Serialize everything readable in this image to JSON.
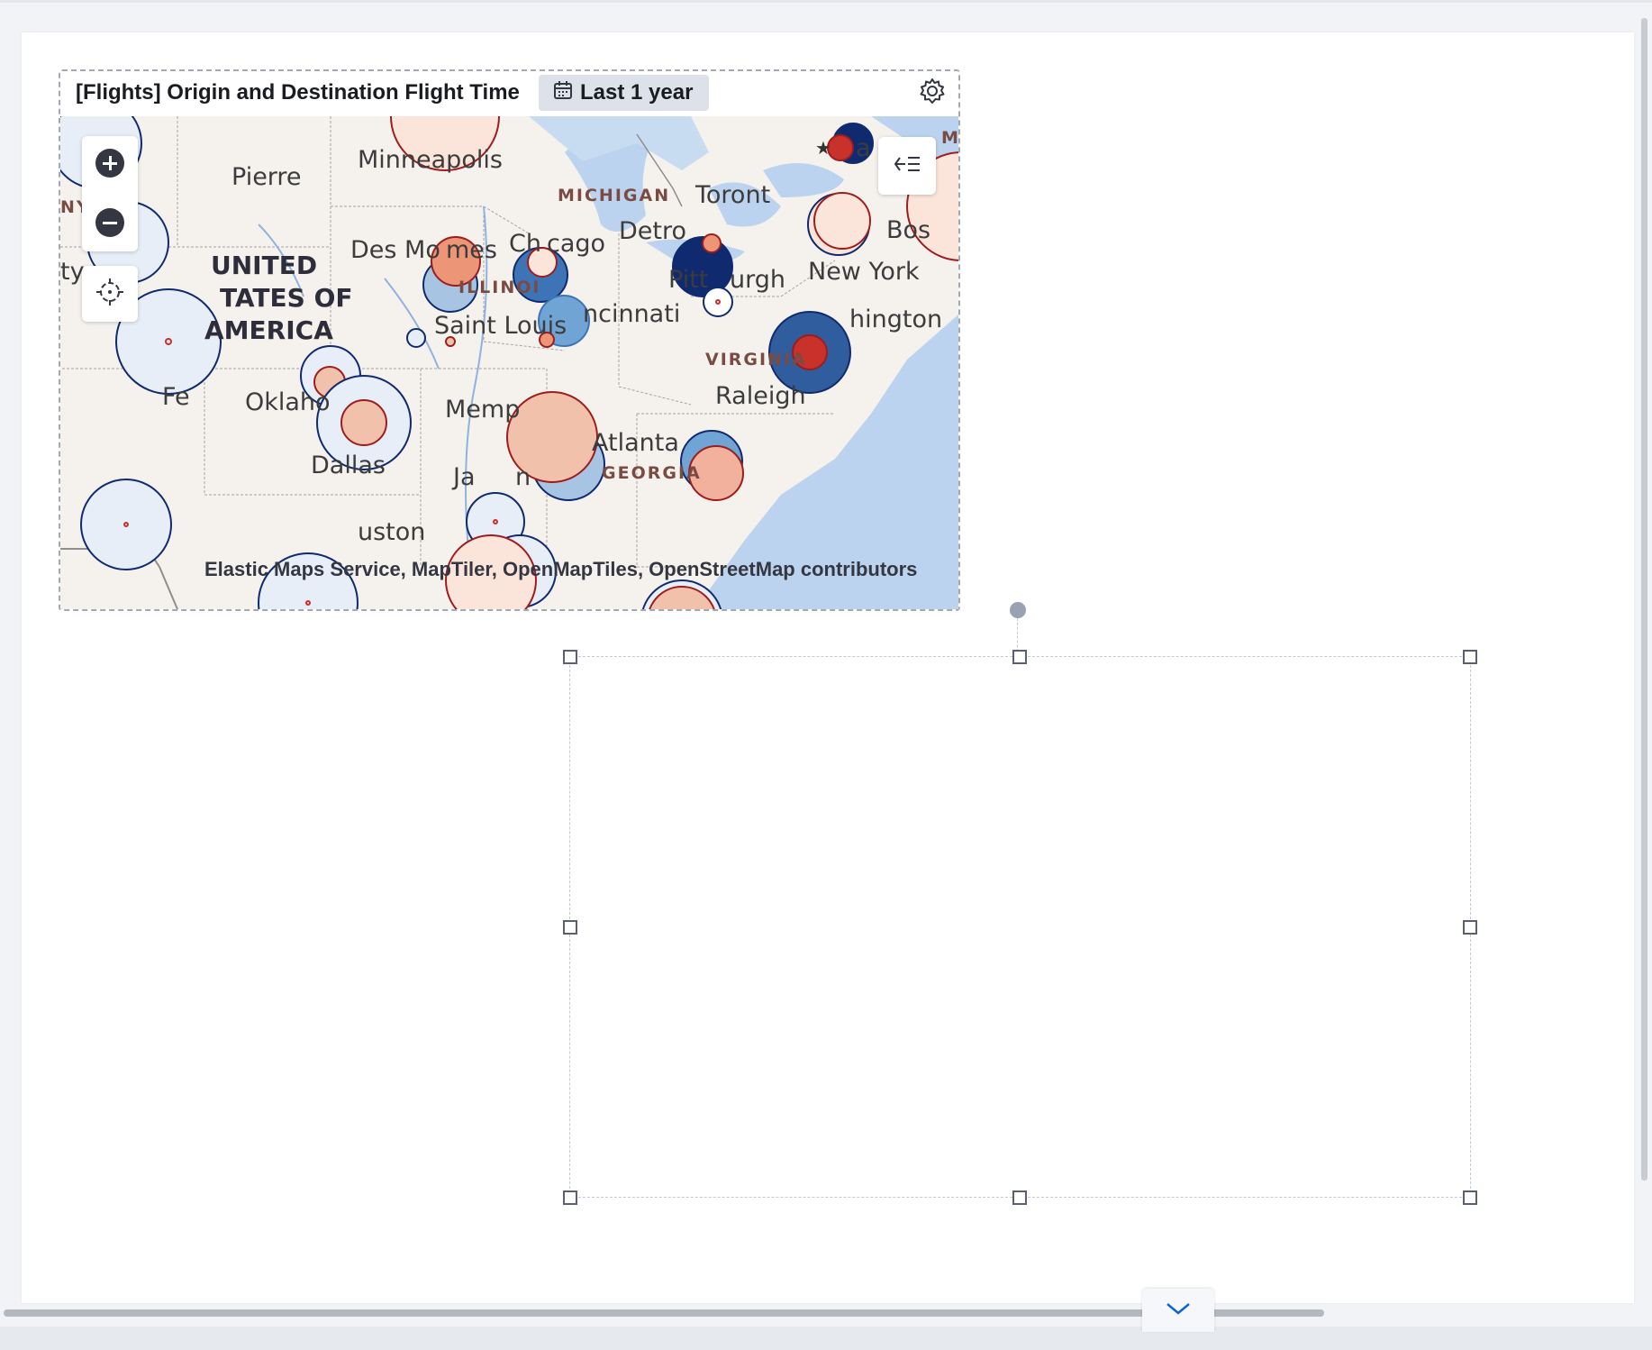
{
  "panel": {
    "title": "[Flights] Origin and Destination Flight Time",
    "time_range": "Last 1 year",
    "attribution": "Elastic Maps Service, MapTiler, OpenMapTiles, OpenStreetMap contributors"
  },
  "map": {
    "cities": [
      "Minneapolis",
      "Pierre",
      "Des Moines",
      "Chicago",
      "Detroit",
      "Toronto",
      "Pittsburgh",
      "New York",
      "Washington",
      "Saint Louis",
      "Cincinnati",
      "Oklahoma City",
      "Memphis",
      "Raleigh",
      "Atlanta",
      "Dallas",
      "Jackson",
      "Houston",
      "Santa Fe",
      "Boston"
    ],
    "city_labels": [
      "Minneapolis",
      "Pierre",
      "Des Mo",
      "mes",
      "Ch",
      "cago",
      "Detro",
      "Toront",
      "Pitt",
      "urgh",
      "New York",
      "hington",
      "Saint Louis",
      "ncinnati",
      "Oklaho",
      "Memp",
      "Raleigh",
      "Atlanta",
      "Dallas",
      "Ja",
      "n",
      "uston",
      "Fe",
      "Bos",
      "ty",
      "a"
    ],
    "states": [
      "MICHIGAN",
      "ILLINOI",
      "VIRGINIA",
      "GEORGIA",
      "NY",
      "M"
    ],
    "country": [
      "UNITED",
      "TATES OF",
      "AMERICA"
    ],
    "colors": {
      "water": "#bcd3ef",
      "land": "#f5f2ee",
      "navy": "#0f2a6e",
      "blue_mid": "#3d74b6",
      "blue_light": "#a7c5e3",
      "blue_pale": "#e8eef8",
      "red": "#c9312b",
      "salmon": "#ec9677",
      "peach": "#f2c1ab",
      "pale_peach": "#fbe5da"
    }
  },
  "controls": {
    "zoom_in": "zoom-in",
    "zoom_out": "zoom-out",
    "locate": "locate",
    "legend": "legend-toggle"
  }
}
